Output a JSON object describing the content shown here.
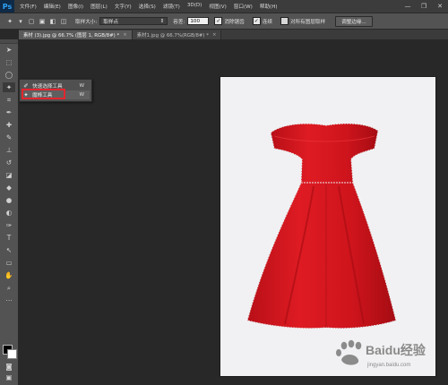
{
  "app": {
    "logo": "Ps"
  },
  "menu": [
    "文件(F)",
    "编辑(E)",
    "图像(I)",
    "图层(L)",
    "文字(Y)",
    "选择(S)",
    "滤镜(T)",
    "3D(D)",
    "视图(V)",
    "窗口(W)",
    "帮助(H)"
  ],
  "window_controls": {
    "minimize": "—",
    "restore": "❐",
    "close": "✕"
  },
  "options": {
    "sample_size_label": "取样大小:",
    "sample_size_value": "取样点",
    "tolerance_label": "容差:",
    "tolerance_value": "100",
    "anti_alias_label": "消除锯齿",
    "contiguous_label": "连续",
    "all_layers_label": "对所有图层取样",
    "refine_edge_button": "调整边缘..."
  },
  "tabs": [
    {
      "label": "素材 (3).jpg @ 66.7% (图层 1, RGB/8#) *",
      "close": "×"
    },
    {
      "label": "素材1.jpg @ 66.7%(RGB/8#) *",
      "close": "×"
    }
  ],
  "flyout": {
    "items": [
      {
        "label": "快速选择工具",
        "shortcut": "W"
      },
      {
        "label": "魔棒工具",
        "shortcut": "W"
      }
    ]
  },
  "watermark": {
    "text": "Baidu经验",
    "subtext": "jingyan.baidu.com"
  },
  "colors": {
    "dress_red": "#d6161e",
    "highlight_box": "#e3262e",
    "ps_blue": "#2fa3f7"
  }
}
